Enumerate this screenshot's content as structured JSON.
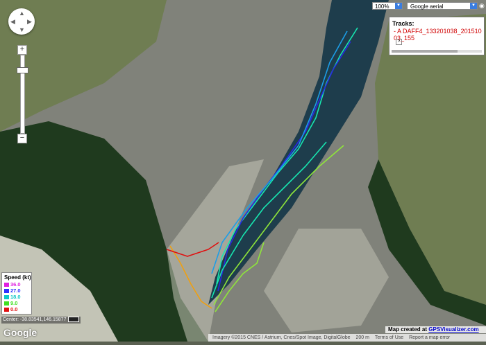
{
  "map": {
    "basemap": "satellite aerial",
    "colors": {
      "water": "#1e3d4c",
      "mudflat": "#80827a",
      "sand": "#c3c4b6",
      "forest": "#1f3a1e",
      "pasture": "#6f7d52"
    },
    "track_colors": {
      "fast": "#2828e0",
      "mid_high": "#1c9ee8",
      "mid": "#17e6b0",
      "mid_low": "#8fe63a",
      "slow": "#f0a010",
      "stop": "#e01010"
    }
  },
  "controls": {
    "pan_icon": "pan-arrows-icon",
    "zoom_in_label": "+",
    "zoom_out_label": "−",
    "zoom_select_value": "100%",
    "map_type_value": "Google aerial",
    "globe_icon": "globe-icon"
  },
  "tracks_panel": {
    "title": "Tracks:",
    "track_name": "- A DAFF4_133201038_20151003_155",
    "checkbox_icon": "checkbox-icon"
  },
  "legend": {
    "title": "Speed (kt)",
    "items": [
      {
        "label": "36.0",
        "color": "#e020e0"
      },
      {
        "label": "27.0",
        "color": "#3030ff"
      },
      {
        "label": "18.0",
        "color": "#10c8c8"
      },
      {
        "label": "9.0",
        "color": "#40e020"
      },
      {
        "label": "0.0",
        "color": "#e01010"
      }
    ]
  },
  "footer": {
    "center": "Center: -38.83541,146.15877",
    "google": "Google",
    "map_created_prefix": "Map created at",
    "map_created_link": "GPSVisualizer.com",
    "imagery": "Imagery ©2015 CNES / Astrium, Cnes/Spot Image, DigitalGlobe",
    "scale": "200 m",
    "terms": "Terms of Use",
    "report": "Report a map error"
  }
}
